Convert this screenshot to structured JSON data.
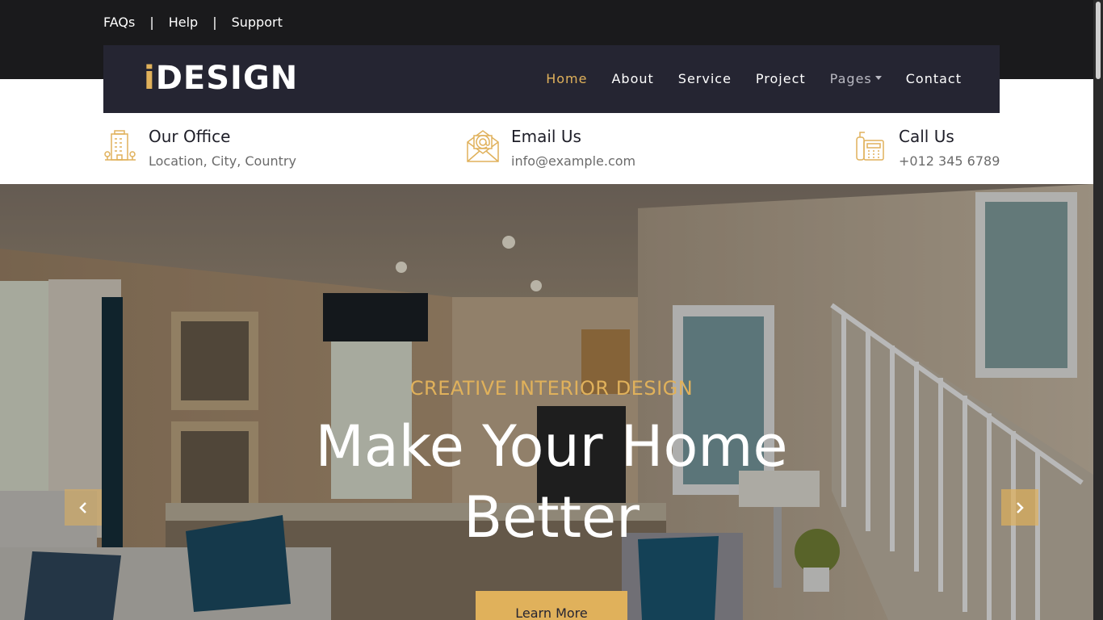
{
  "topbar": {
    "links": [
      "FAQs",
      "Help",
      "Support"
    ],
    "separator": "|"
  },
  "brand": {
    "accent": "i",
    "rest": "DESIGN"
  },
  "nav": {
    "items": [
      {
        "label": "Home",
        "active": true
      },
      {
        "label": "About"
      },
      {
        "label": "Service"
      },
      {
        "label": "Project"
      },
      {
        "label": "Pages",
        "dropdown": true
      },
      {
        "label": "Contact"
      }
    ]
  },
  "contact": {
    "office": {
      "title": "Our Office",
      "text": "Location, City, Country",
      "icon": "building-icon"
    },
    "email": {
      "title": "Email Us",
      "text": "info@example.com",
      "icon": "envelope-icon"
    },
    "call": {
      "title": "Call Us",
      "text": "+012 345 6789",
      "icon": "phone-icon"
    }
  },
  "hero": {
    "subtitle": "CREATIVE INTERIOR DESIGN",
    "title_line1": "Make Your Home",
    "title_line2": "Better",
    "button": "Learn More",
    "prev_icon": "chevron-left-icon",
    "next_icon": "chevron-right-icon"
  },
  "colors": {
    "accent": "#e0b15b",
    "navbar": "#252532",
    "topbar": "#1a1a1c"
  }
}
